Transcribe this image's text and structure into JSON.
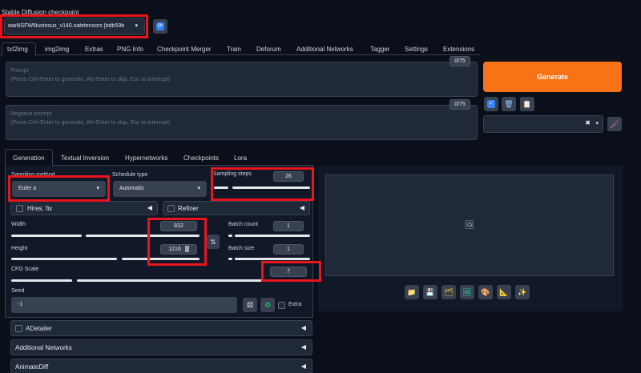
{
  "header": {
    "checkpoint_label": "Stable Diffusion checkpoint",
    "checkpoint_value": "waiNSFWIllustrious_v140.safetensors [bdb59b",
    "refresh_icon": "refresh-icon"
  },
  "main_tabs": [
    "txt2img",
    "img2img",
    "Extras",
    "PNG Info",
    "Checkpoint Merger",
    "Train",
    "Deforum",
    "Additional Networks",
    "Tagger",
    "Settings",
    "Extensions"
  ],
  "prompt": {
    "label": "Prompt",
    "placeholder": "(Press Ctrl+Enter to generate, Alt+Enter to skip, Esc to interrupt)",
    "counter": "0/75"
  },
  "negative_prompt": {
    "label": "Negative prompt",
    "placeholder": "(Press Ctrl+Enter to generate, Alt+Enter to skip, Esc to interrupt)",
    "counter": "0/75"
  },
  "generate_button": "Generate",
  "sub_tabs": [
    "Generation",
    "Textual Inversion",
    "Hypernetworks",
    "Checkpoints",
    "Lora"
  ],
  "sampling": {
    "method_label": "Sampling method",
    "method_value": "Euler a",
    "schedule_label": "Schedule type",
    "schedule_value": "Automatic",
    "steps_label": "Sampling steps",
    "steps_value": "26"
  },
  "hires_fix": "Hires. fix",
  "refiner": "Refiner",
  "width": {
    "label": "Width",
    "value": "832"
  },
  "height": {
    "label": "Height",
    "value": "1216"
  },
  "batch_count": {
    "label": "Batch count",
    "value": "1"
  },
  "batch_size": {
    "label": "Batch size",
    "value": "1"
  },
  "cfg": {
    "label": "CFG Scale",
    "value": "7"
  },
  "seed": {
    "label": "Seed",
    "value": "-1",
    "extra_label": "Extra"
  },
  "accordions": [
    "ADetailer",
    "Additional Networks",
    "AnimateDiff"
  ],
  "colors": {
    "generate": "#f97316",
    "highlight": "#e8141e",
    "background": "#0b0f19"
  }
}
